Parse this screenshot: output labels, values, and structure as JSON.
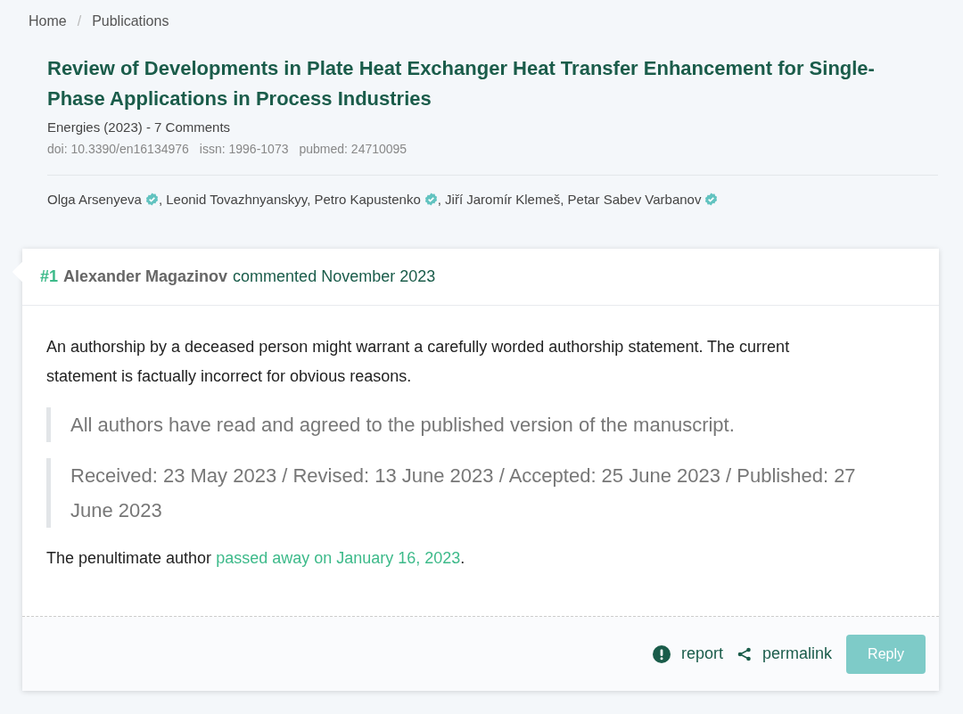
{
  "breadcrumbs": [
    {
      "label": "Home"
    },
    {
      "label": "Publications",
      "separator": "/"
    }
  ],
  "publication": {
    "title": "Review of Developments in Plate Heat Exchanger Heat Transfer Enhancement for Single-Phase Applications in Process Industries",
    "journal_line": "Energies (2023) - 7 Comments",
    "identifiers": [
      "doi: 10.3390/en16134976",
      "issn: 1996-1073",
      "pubmed: 24710095"
    ],
    "authors": [
      {
        "name": "Olga Arsenyeva",
        "verified": true,
        "separator": ","
      },
      {
        "name": "Leonid Tovazhnyanskyy",
        "verified": false,
        "separator": ","
      },
      {
        "name": "Petro Kapustenko",
        "verified": true,
        "separator": ","
      },
      {
        "name": "Jiří Jaromír Klemeš",
        "verified": false,
        "separator": ","
      },
      {
        "name": "Petar Sabev Varbanov",
        "verified": true
      }
    ]
  },
  "comment": {
    "number": "#1",
    "author": "Alexander Magazinov",
    "meta": "commented November 2023",
    "body": [
      {
        "kind": "paragraph",
        "parts": [
          {
            "text": "An authorship by a deceased person might warrant a carefully worded authorship statement. The current statement is factually incorrect for obvious reasons.",
            "link": false
          }
        ]
      },
      {
        "kind": "quote",
        "parts": [
          {
            "text": "All authors have read and agreed to the published version of the manuscript.",
            "link": false
          }
        ]
      },
      {
        "kind": "quote",
        "parts": [
          {
            "text": "Received: 23 May 2023 / Revised: 13 June 2023 / Accepted: 25 June 2023 / Published: 27 June 2023",
            "link": false
          }
        ]
      },
      {
        "kind": "paragraph",
        "parts": [
          {
            "text": "The penultimate author ",
            "link": false
          },
          {
            "text": "passed away on January 16, 2023",
            "link": true
          },
          {
            "text": ".",
            "link": false
          }
        ]
      }
    ],
    "actions": {
      "report": "report",
      "permalink": "permalink",
      "reply": "Reply"
    }
  }
}
